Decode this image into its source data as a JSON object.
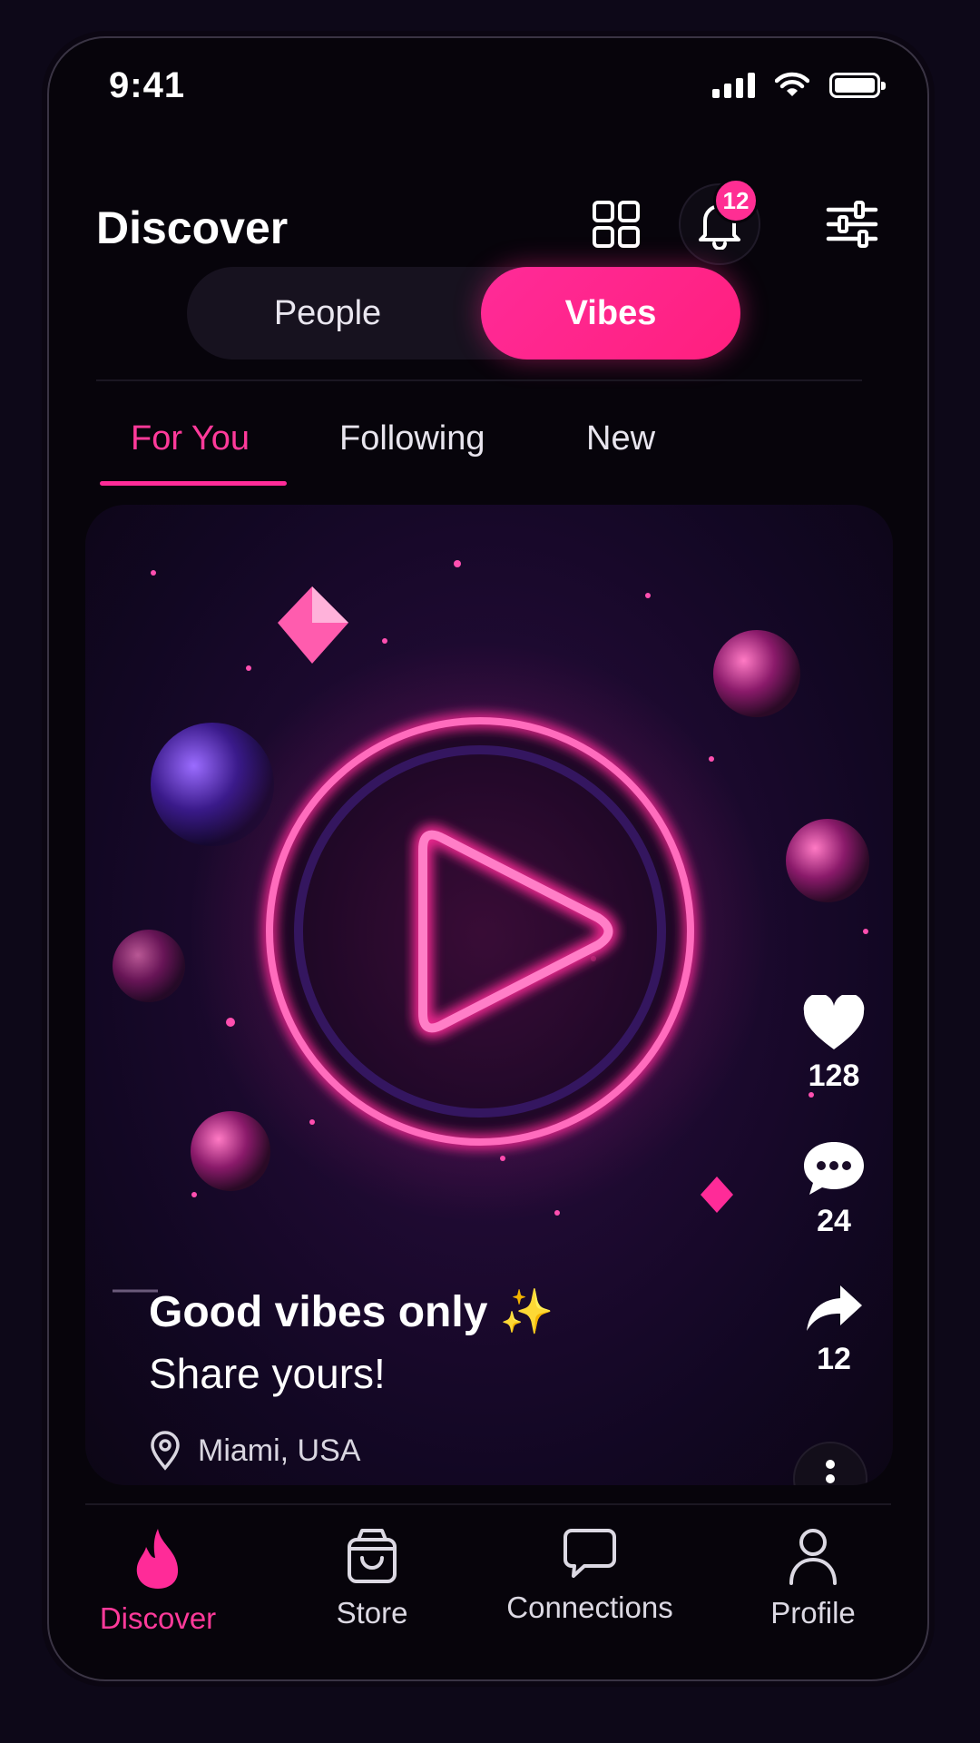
{
  "status": {
    "time": "9:41"
  },
  "header": {
    "title": "Discover",
    "notification_count": "12"
  },
  "segmented": {
    "options": [
      "People",
      "Vibes"
    ],
    "selected": "Vibes"
  },
  "tabs": [
    {
      "label": "For You",
      "active": true
    },
    {
      "label": "Following",
      "active": false
    },
    {
      "label": "New",
      "active": false
    }
  ],
  "post": {
    "title": "Good vibes only ✨",
    "subtitle": "Share yours!",
    "location": "Miami, USA",
    "likes": "128",
    "comments": "24",
    "shares": "12"
  },
  "nav": {
    "items": [
      {
        "label": "Discover",
        "icon": "flame-icon",
        "active": true
      },
      {
        "label": "Store",
        "icon": "shopping-bag-icon",
        "active": false
      },
      {
        "label": "Connections",
        "icon": "chat-icon",
        "active": false
      },
      {
        "label": "Profile",
        "icon": "person-icon",
        "active": false
      }
    ]
  },
  "colors": {
    "accent": "#ff2b98",
    "background": "#07040b"
  }
}
